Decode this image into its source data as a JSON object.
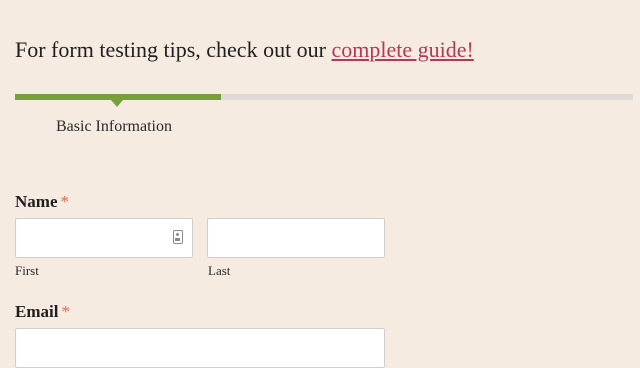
{
  "intro": {
    "text": "For form testing tips, check out our",
    "link_label": "complete guide!"
  },
  "progress": {
    "fraction": 0.333,
    "step_label": "Basic Information",
    "fill_color": "#78a03a",
    "track_color": "#dedad6"
  },
  "fields": {
    "name": {
      "label": "Name",
      "required_marker": "*",
      "first": {
        "value": "",
        "sublabel": "First"
      },
      "last": {
        "value": "",
        "sublabel": "Last"
      },
      "autofill_icon": "contact-card-icon"
    },
    "email": {
      "label": "Email",
      "required_marker": "*",
      "value": ""
    }
  },
  "colors": {
    "background": "#f5ebe0",
    "link": "#b23a55",
    "required": "#e0694f"
  }
}
